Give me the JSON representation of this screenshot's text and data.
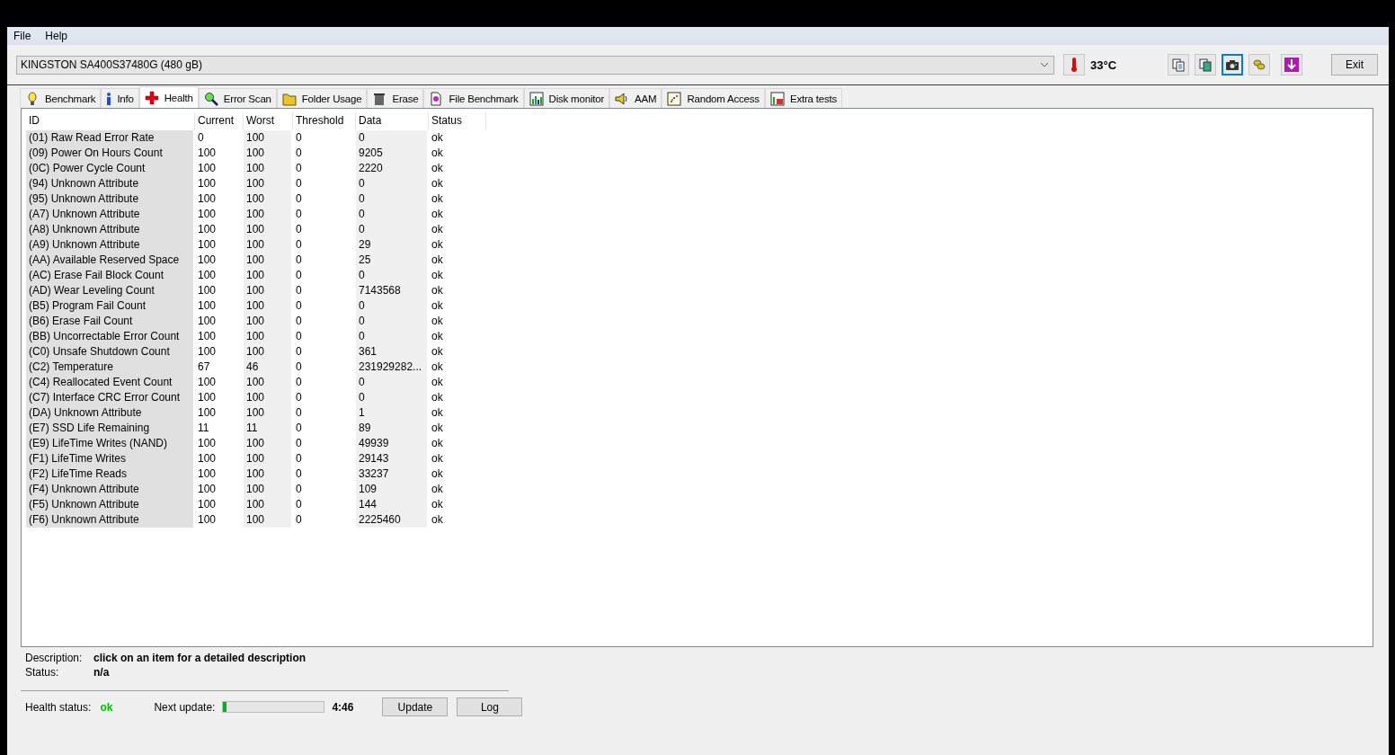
{
  "menu": [
    "File",
    "Help"
  ],
  "drive": {
    "value": "KINGSTON SA400S37480G (480 gB)"
  },
  "temperature": "33°C",
  "toolbar_buttons": [
    {
      "focused": false
    },
    {
      "focused": false
    },
    {
      "focused": true
    },
    {
      "focused": false
    },
    {
      "focused": false
    }
  ],
  "exit_button": "Exit",
  "tabs": [
    {
      "label": "Benchmark",
      "selected": false
    },
    {
      "label": "Info",
      "selected": false
    },
    {
      "label": "Health",
      "selected": true
    },
    {
      "label": "Error Scan",
      "selected": false
    },
    {
      "label": "Folder Usage",
      "selected": false
    },
    {
      "label": "Erase",
      "selected": false
    },
    {
      "label": "File Benchmark",
      "selected": false
    },
    {
      "label": "Disk monitor",
      "selected": false
    },
    {
      "label": "AAM",
      "selected": false
    },
    {
      "label": "Random Access",
      "selected": false
    },
    {
      "label": "Extra tests",
      "selected": false
    }
  ],
  "table": {
    "columns": [
      "ID",
      "Current",
      "Worst",
      "Threshold",
      "Data",
      "Status"
    ],
    "rows": [
      [
        "(01) Raw Read Error Rate",
        "0",
        "100",
        "0",
        "0",
        "ok"
      ],
      [
        "(09) Power On Hours Count",
        "100",
        "100",
        "0",
        "9205",
        "ok"
      ],
      [
        "(0C) Power Cycle Count",
        "100",
        "100",
        "0",
        "2220",
        "ok"
      ],
      [
        "(94) Unknown Attribute",
        "100",
        "100",
        "0",
        "0",
        "ok"
      ],
      [
        "(95) Unknown Attribute",
        "100",
        "100",
        "0",
        "0",
        "ok"
      ],
      [
        "(A7) Unknown Attribute",
        "100",
        "100",
        "0",
        "0",
        "ok"
      ],
      [
        "(A8) Unknown Attribute",
        "100",
        "100",
        "0",
        "0",
        "ok"
      ],
      [
        "(A9) Unknown Attribute",
        "100",
        "100",
        "0",
        "29",
        "ok"
      ],
      [
        "(AA) Available Reserved Space",
        "100",
        "100",
        "0",
        "25",
        "ok"
      ],
      [
        "(AC) Erase Fail Block Count",
        "100",
        "100",
        "0",
        "0",
        "ok"
      ],
      [
        "(AD) Wear Leveling Count",
        "100",
        "100",
        "0",
        "7143568",
        "ok"
      ],
      [
        "(B5) Program Fail Count",
        "100",
        "100",
        "0",
        "0",
        "ok"
      ],
      [
        "(B6) Erase Fail Count",
        "100",
        "100",
        "0",
        "0",
        "ok"
      ],
      [
        "(BB) Uncorrectable Error Count",
        "100",
        "100",
        "0",
        "0",
        "ok"
      ],
      [
        "(C0) Unsafe Shutdown Count",
        "100",
        "100",
        "0",
        "361",
        "ok"
      ],
      [
        "(C2) Temperature",
        "67",
        "46",
        "0",
        "231929282...",
        "ok"
      ],
      [
        "(C4) Reallocated Event Count",
        "100",
        "100",
        "0",
        "0",
        "ok"
      ],
      [
        "(C7) Interface CRC Error Count",
        "100",
        "100",
        "0",
        "0",
        "ok"
      ],
      [
        "(DA) Unknown Attribute",
        "100",
        "100",
        "0",
        "1",
        "ok"
      ],
      [
        "(E7) SSD Life Remaining",
        "11",
        "11",
        "0",
        "89",
        "ok"
      ],
      [
        "(E9) LifeTime Writes (NAND)",
        "100",
        "100",
        "0",
        "49939",
        "ok"
      ],
      [
        "(F1) LifeTime Writes",
        "100",
        "100",
        "0",
        "29143",
        "ok"
      ],
      [
        "(F2) LifeTime Reads",
        "100",
        "100",
        "0",
        "33237",
        "ok"
      ],
      [
        "(F4) Unknown Attribute",
        "100",
        "100",
        "0",
        "109",
        "ok"
      ],
      [
        "(F5) Unknown Attribute",
        "100",
        "100",
        "0",
        "144",
        "ok"
      ],
      [
        "(F6) Unknown Attribute",
        "100",
        "100",
        "0",
        "2225460",
        "ok"
      ]
    ]
  },
  "description": {
    "label": "Description:",
    "value": "click on an item for a detailed description"
  },
  "status": {
    "label": "Status:",
    "value": "n/a"
  },
  "health_status": {
    "label": "Health status:",
    "value": "ok"
  },
  "next_update": {
    "label": "Next update:",
    "level": 0.03,
    "reading": "4:46"
  },
  "buttons": [
    "Update",
    "Log"
  ]
}
